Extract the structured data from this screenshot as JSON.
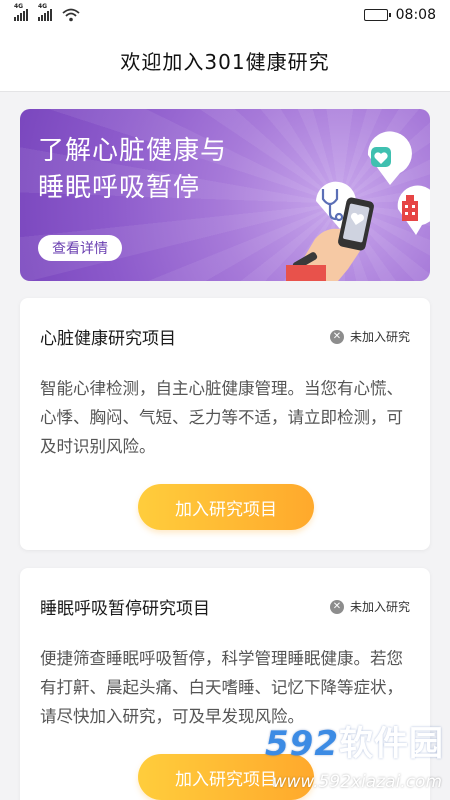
{
  "status_bar": {
    "signal_tag_1": "4G",
    "signal_tag_2": "4G",
    "time": "08:08"
  },
  "header": {
    "title": "欢迎加入301健康研究"
  },
  "banner": {
    "title_line1": "了解心脏健康与",
    "title_line2": "睡眠呼吸暂停",
    "button_label": "查看详情"
  },
  "cards": [
    {
      "title": "心脏健康研究项目",
      "status": "未加入研究",
      "description": "智能心律检测，自主心脏健康管理。当您有心慌、心悸、胸闷、气短、乏力等不适，请立即检测，可及时识别风险。",
      "button_label": "加入研究项目"
    },
    {
      "title": "睡眠呼吸暂停研究项目",
      "status": "未加入研究",
      "description": "便捷筛查睡眠呼吸暂停，科学管理睡眠健康。若您有打鼾、晨起头痛、白天嗜睡、记忆下降等症状，请尽快加入研究，可及早发现风险。",
      "button_label": "加入研究项目"
    }
  ],
  "watermark": {
    "logo_num": "592",
    "logo_text": "软件园",
    "url": "www.592xiazai.com"
  },
  "colors": {
    "accent_purple": "#8c5acb",
    "button_orange": "#ffa92c",
    "button_yellow": "#ffcd3c"
  }
}
